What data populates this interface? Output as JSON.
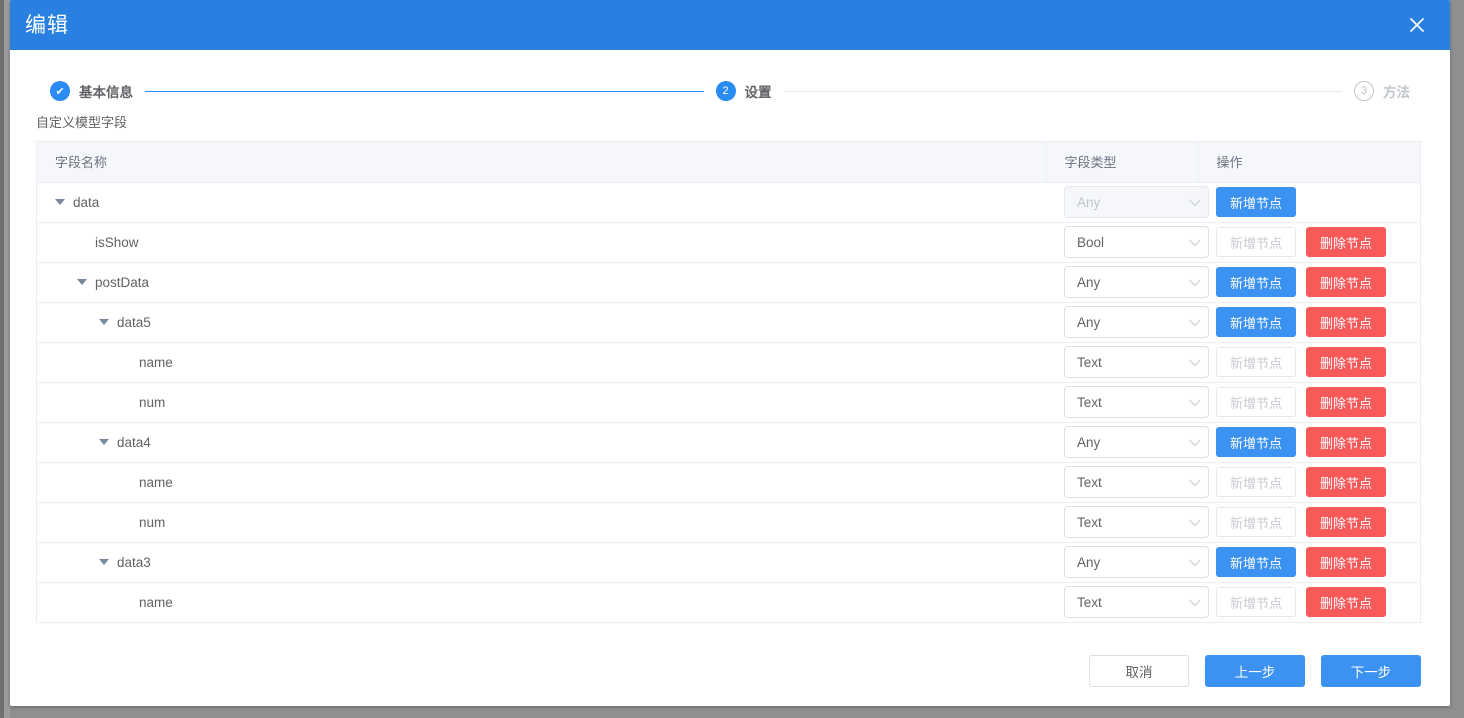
{
  "modal": {
    "title": "编辑",
    "close_icon": "close-icon"
  },
  "stepper": {
    "steps": [
      {
        "marker": "✔",
        "label": "基本信息",
        "state": "done"
      },
      {
        "marker": "2",
        "label": "设置",
        "state": "active"
      },
      {
        "marker": "3",
        "label": "方法",
        "state": "todo"
      }
    ]
  },
  "section": {
    "label": "自定义模型字段"
  },
  "table": {
    "headers": [
      "字段名称",
      "字段类型",
      "操作"
    ],
    "buttons": {
      "add": "新增节点",
      "delete": "删除节点"
    },
    "rows": [
      {
        "name": "data",
        "indent": 0,
        "caret": true,
        "type": "Any",
        "type_disabled": true,
        "add_disabled": false,
        "has_delete": false
      },
      {
        "name": "isShow",
        "indent": 1,
        "caret": false,
        "type": "Bool",
        "type_disabled": false,
        "add_disabled": true,
        "has_delete": true
      },
      {
        "name": "postData",
        "indent": 1,
        "caret": true,
        "type": "Any",
        "type_disabled": false,
        "add_disabled": false,
        "has_delete": true
      },
      {
        "name": "data5",
        "indent": 2,
        "caret": true,
        "type": "Any",
        "type_disabled": false,
        "add_disabled": false,
        "has_delete": true
      },
      {
        "name": "name",
        "indent": 3,
        "caret": false,
        "type": "Text",
        "type_disabled": false,
        "add_disabled": true,
        "has_delete": true
      },
      {
        "name": "num",
        "indent": 3,
        "caret": false,
        "type": "Text",
        "type_disabled": false,
        "add_disabled": true,
        "has_delete": true
      },
      {
        "name": "data4",
        "indent": 2,
        "caret": true,
        "type": "Any",
        "type_disabled": false,
        "add_disabled": false,
        "has_delete": true
      },
      {
        "name": "name",
        "indent": 3,
        "caret": false,
        "type": "Text",
        "type_disabled": false,
        "add_disabled": true,
        "has_delete": true
      },
      {
        "name": "num",
        "indent": 3,
        "caret": false,
        "type": "Text",
        "type_disabled": false,
        "add_disabled": true,
        "has_delete": true
      },
      {
        "name": "data3",
        "indent": 2,
        "caret": true,
        "type": "Any",
        "type_disabled": false,
        "add_disabled": false,
        "has_delete": true
      },
      {
        "name": "name",
        "indent": 3,
        "caret": false,
        "type": "Text",
        "type_disabled": false,
        "add_disabled": true,
        "has_delete": true
      }
    ]
  },
  "footer": {
    "cancel": "取消",
    "prev": "上一步",
    "next": "下一步"
  },
  "colors": {
    "header_blue": "#2A80E0",
    "primary_blue": "#3C92F0",
    "step_blue": "#2A8BF2",
    "danger_red": "#F85A5A",
    "border": "#ebeef5",
    "header_bg": "#f5f7fa",
    "text": "#606266",
    "muted": "#c0c4cc"
  }
}
